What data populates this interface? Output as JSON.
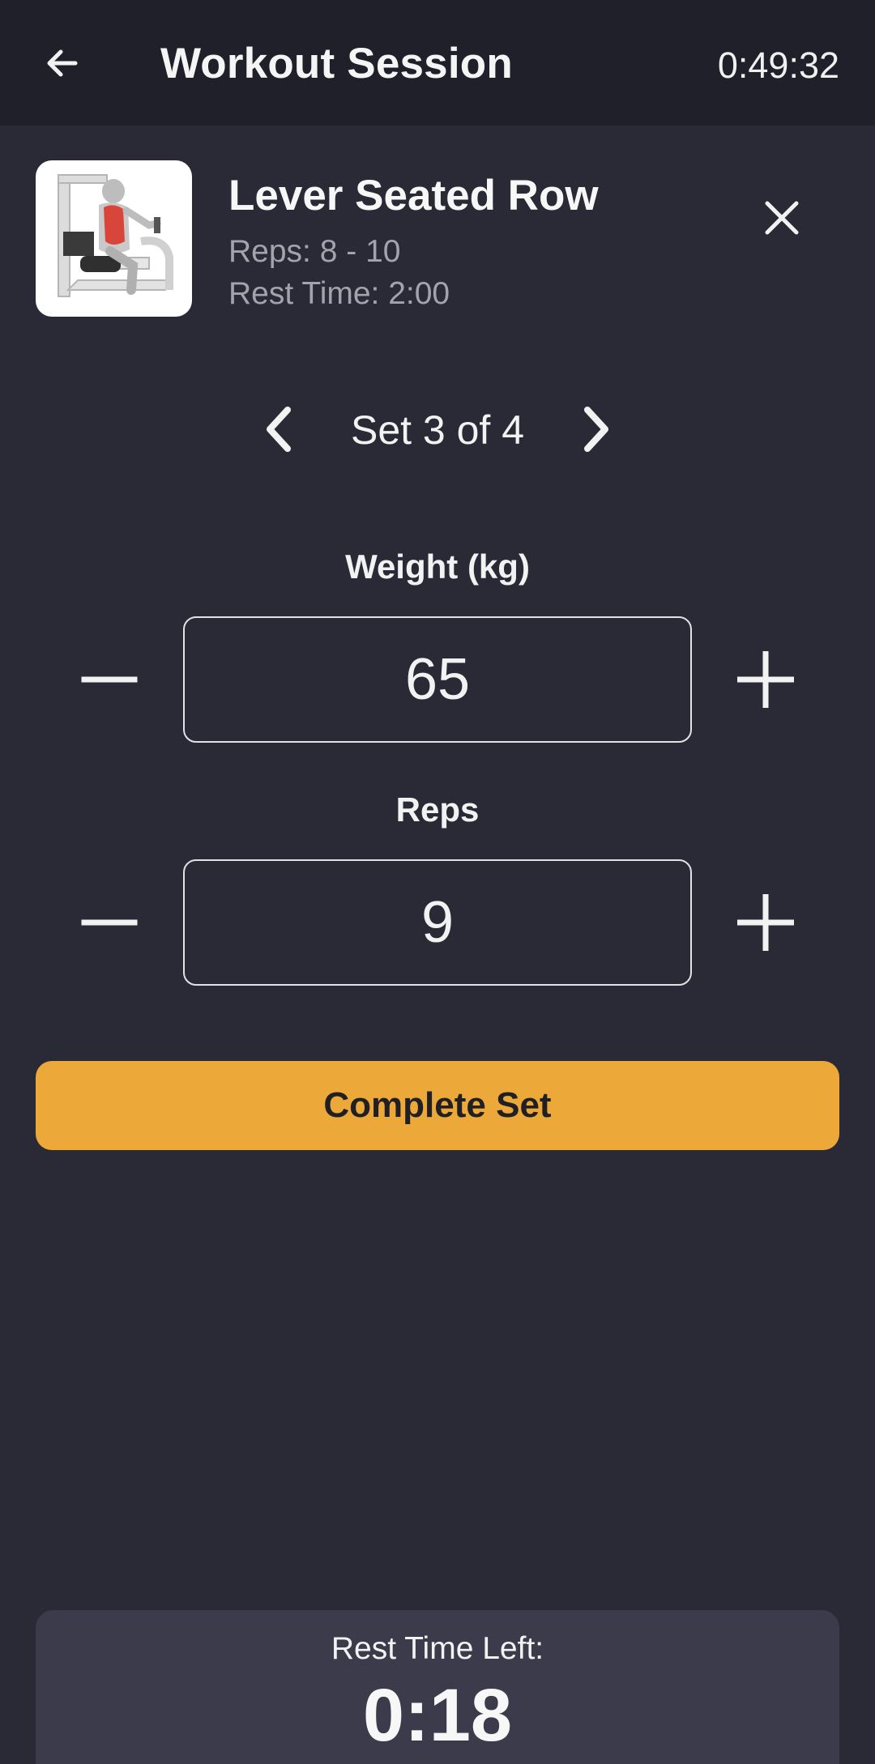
{
  "header": {
    "title": "Workout Session",
    "elapsed_time": "0:49:32",
    "back_icon": "arrow-left-icon"
  },
  "exercise": {
    "name": "Lever Seated Row",
    "reps_range": "Reps: 8 - 10",
    "rest_time": "Rest Time: 2:00",
    "thumbnail": "lever-seated-row-illustration",
    "close_icon": "close-icon"
  },
  "set_navigator": {
    "label": "Set 3 of 4",
    "prev_icon": "chevron-left-icon",
    "next_icon": "chevron-right-icon"
  },
  "weight": {
    "label": "Weight (kg)",
    "value": "65"
  },
  "reps": {
    "label": "Reps",
    "value": "9"
  },
  "actions": {
    "complete_set_label": "Complete Set"
  },
  "rest_timer": {
    "label": "Rest Time Left:",
    "value": "0:18"
  },
  "colors": {
    "background": "#2a2a37",
    "topbar": "#20202b",
    "accent": "#eca93a",
    "rest_panel": "#3c3b4b"
  }
}
